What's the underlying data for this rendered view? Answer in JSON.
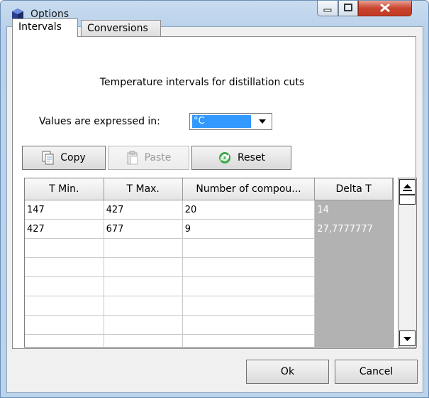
{
  "window": {
    "title": "Options"
  },
  "tabs": [
    {
      "label": "Intervals",
      "active": true
    },
    {
      "label": "Conversions",
      "active": false
    }
  ],
  "intervals": {
    "heading": "Temperature intervals for distillation cuts",
    "units_label": "Values are expressed in:",
    "units_value": "°C",
    "buttons": {
      "copy": "Copy",
      "paste": "Paste",
      "reset": "Reset"
    },
    "grid": {
      "columns": [
        "T Min.",
        "T Max.",
        "Number of compou...",
        "Delta T"
      ],
      "rows": [
        [
          "147",
          "427",
          "20",
          "14"
        ],
        [
          "427",
          "677",
          "9",
          "27,7777777"
        ],
        [
          "",
          "",
          "",
          ""
        ],
        [
          "",
          "",
          "",
          ""
        ],
        [
          "",
          "",
          "",
          ""
        ],
        [
          "",
          "",
          "",
          ""
        ],
        [
          "",
          "",
          "",
          ""
        ],
        [
          "",
          "",
          "",
          ""
        ]
      ]
    }
  },
  "footer": {
    "ok": "Ok",
    "cancel": "Cancel"
  },
  "colors": {
    "selection": "#3399ff",
    "disabled_cell": "#b2b2b2",
    "close_button": "#c9452f"
  },
  "icons": [
    "app-icon",
    "minimize-icon",
    "maximize-icon",
    "close-icon",
    "copy-icon",
    "paste-icon",
    "reset-icon",
    "scroll-up-icon",
    "scroll-down-icon",
    "dropdown-arrow-icon"
  ]
}
